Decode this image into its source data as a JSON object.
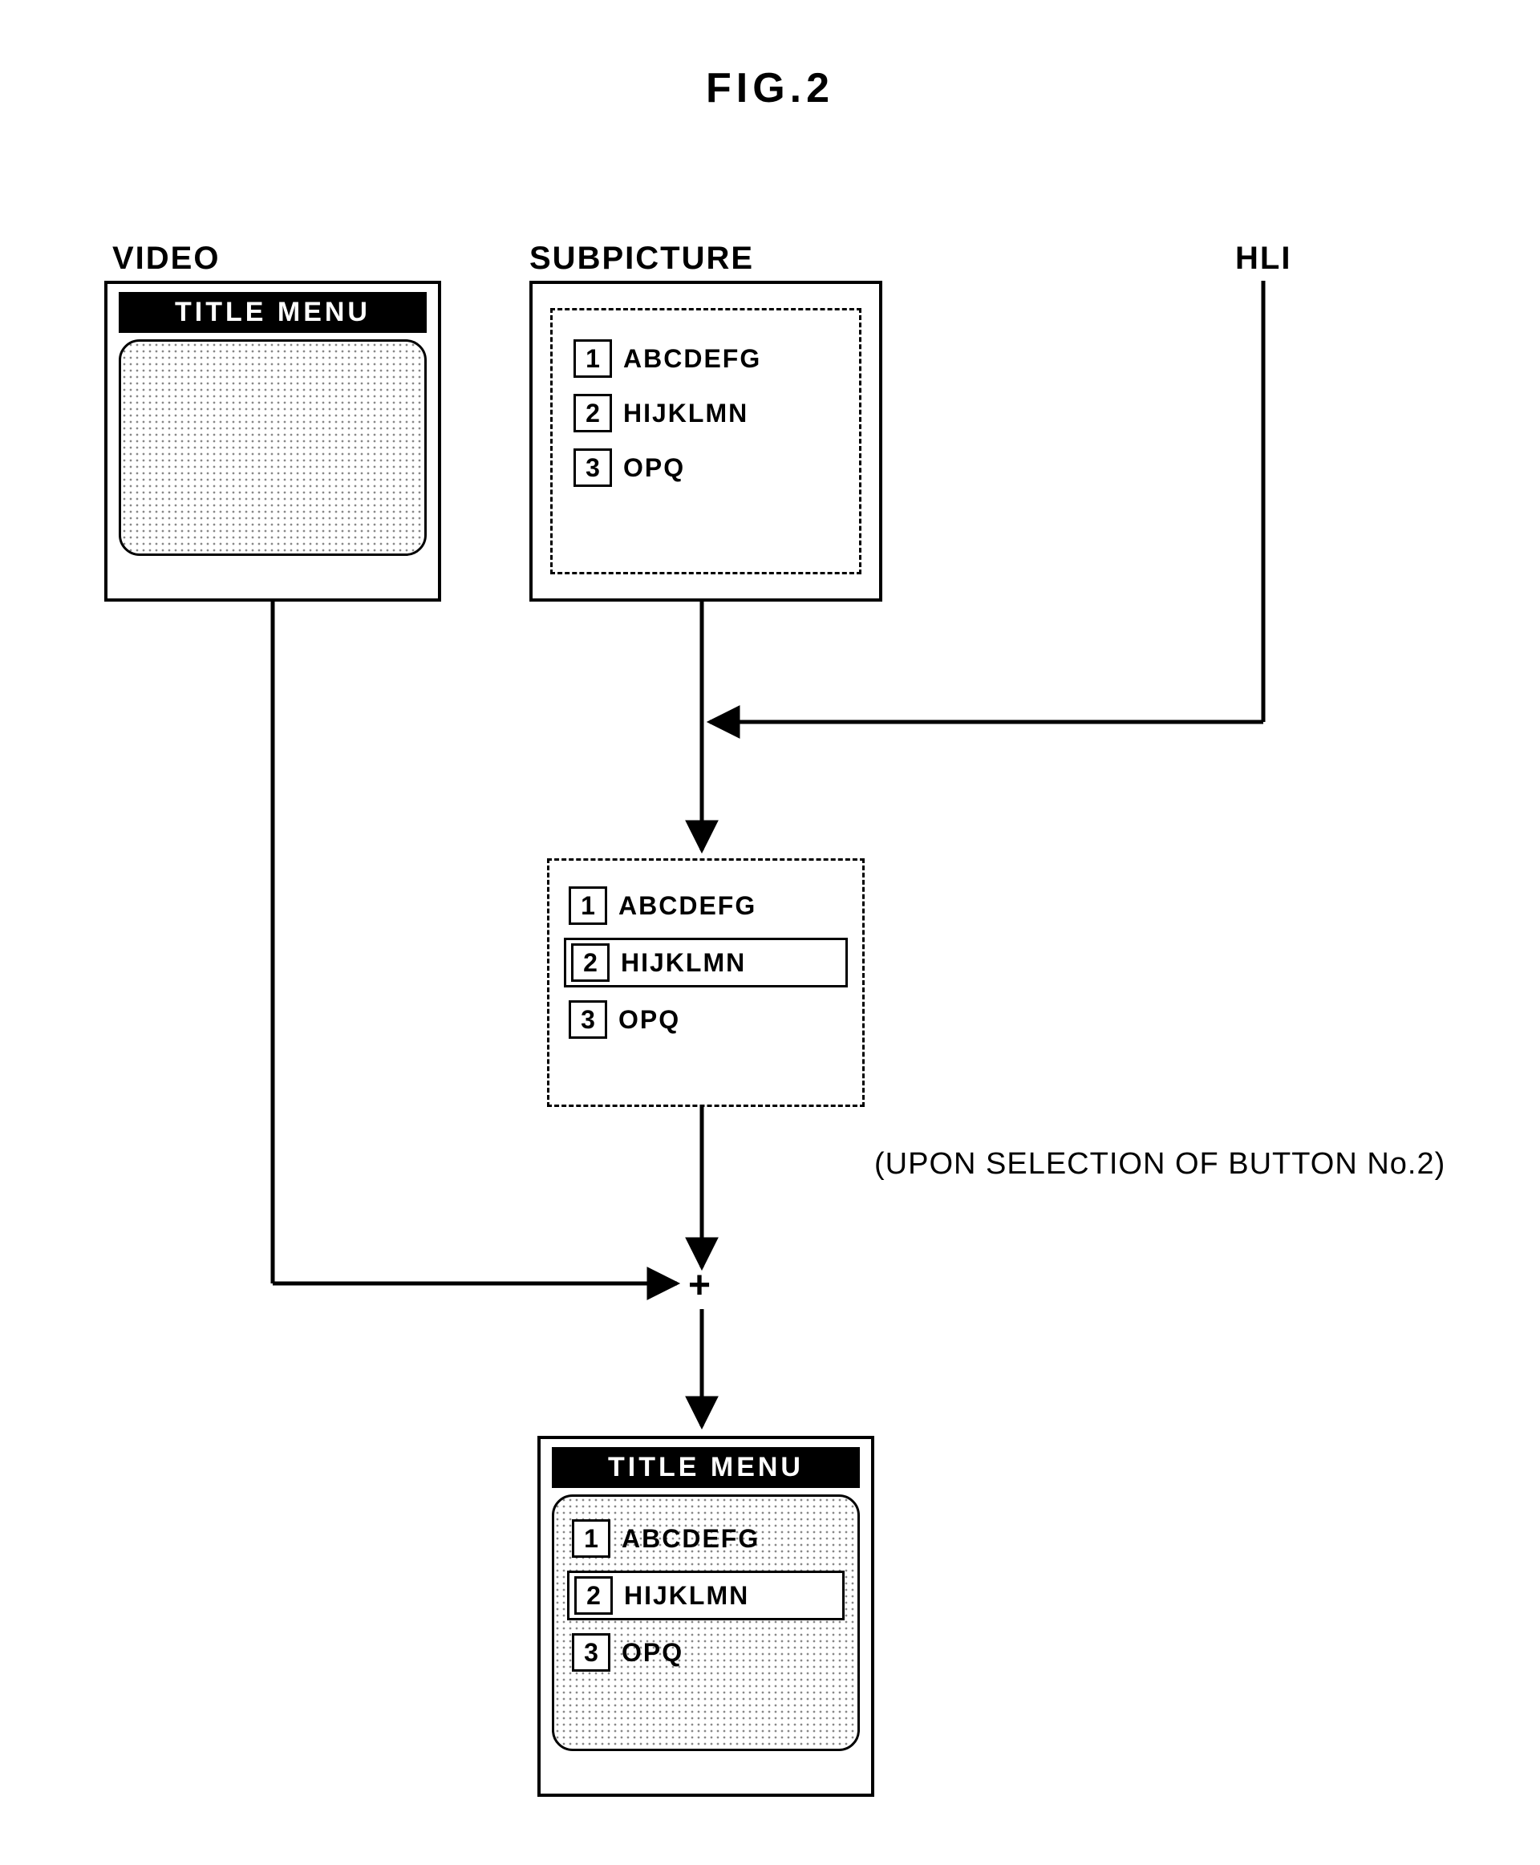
{
  "figure_title": "FIG.2",
  "labels": {
    "video": "VIDEO",
    "subpicture": "SUBPICTURE",
    "hli": "HLI"
  },
  "title_menu": "TITLE MENU",
  "menu_items": [
    {
      "n": "1",
      "text": "ABCDEFG"
    },
    {
      "n": "2",
      "text": "HIJKLMN"
    },
    {
      "n": "3",
      "text": "OPQ"
    }
  ],
  "note": "(UPON SELECTION OF BUTTON No.2)",
  "plus": "+"
}
